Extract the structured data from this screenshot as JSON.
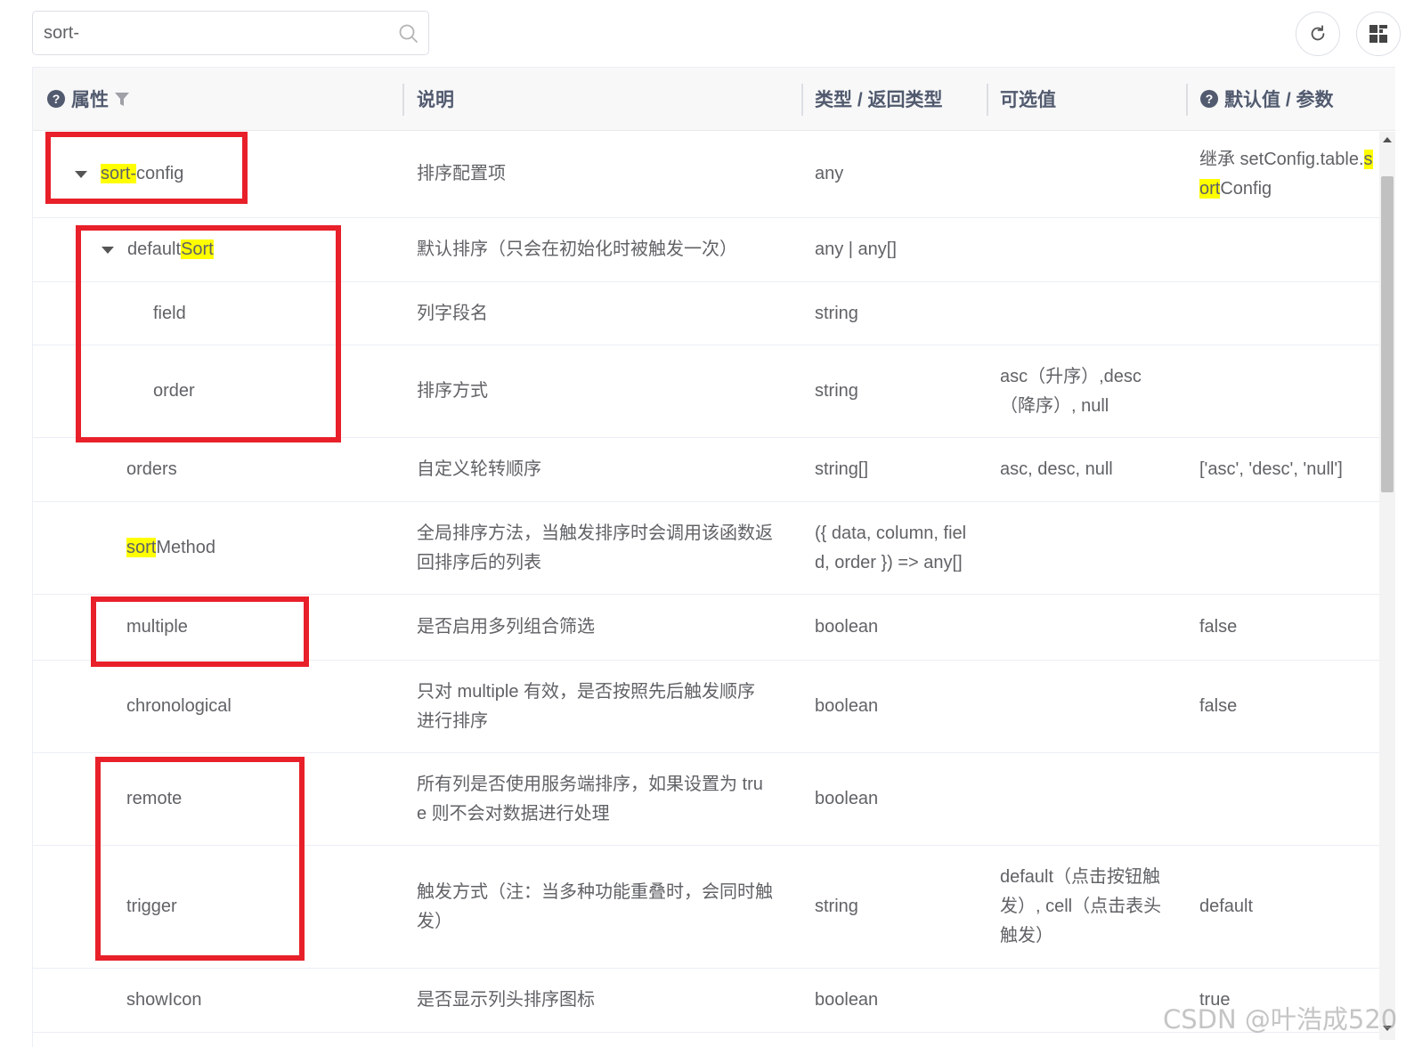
{
  "search": {
    "value": "sort-",
    "search_icon": "search-icon"
  },
  "toolbar": {
    "refresh_icon": "refresh-icon",
    "columns_icon": "grid-columns-icon"
  },
  "table": {
    "headers": {
      "attr": "属性",
      "desc": "说明",
      "type": "类型 / 返回类型",
      "options": "可选值",
      "default": "默认值 / 参数"
    },
    "rows": [
      {
        "name_pre": "",
        "name_hl": "sort-",
        "name_post": "config",
        "desc": "排序配置项",
        "type": "any",
        "options": "",
        "default_1_pre": "继承 setConfig.table.",
        "default_1_hl": "s",
        "default_2_hl": "ort",
        "default_2_post": "Config"
      },
      {
        "name_pre": "defaultSort_left",
        "name_pre_text": "default",
        "name_hl": "Sort",
        "desc": "默认排序（只会在初始化时被触发一次）",
        "type": "any | any[]",
        "options": "",
        "default": ""
      },
      {
        "name": "field",
        "desc": "列字段名",
        "type": "string",
        "options": "",
        "default": ""
      },
      {
        "name": "order",
        "desc": "排序方式",
        "type": "string",
        "options_1": "asc（升序）,desc",
        "options_2": "（降序）, null",
        "default": ""
      },
      {
        "name": "orders",
        "desc": "自定义轮转顺序",
        "type": "string[]",
        "options": "asc, desc, null",
        "default": "['asc', 'desc', 'null']"
      },
      {
        "name_hl": "sort",
        "name_post": "Method",
        "desc_1": "全局排序方法，当触发排序时会调用该函数返",
        "desc_2": "回排序后的列表",
        "type_1": "({ data, column, fiel",
        "type_2": "d, order }) => any[]",
        "options": "",
        "default": ""
      },
      {
        "name": "multiple",
        "desc": "是否启用多列组合筛选",
        "type": "boolean",
        "options": "",
        "default": "false"
      },
      {
        "name": "chronological",
        "desc_1": "只对 multiple 有效，是否按照先后触发顺序",
        "desc_2": "进行排序",
        "type": "boolean",
        "options": "",
        "default": "false"
      },
      {
        "name": "remote",
        "desc_1": "所有列是否使用服务端排序，如果设置为 tru",
        "desc_2": "e 则不会对数据进行处理",
        "type": "boolean",
        "options": "",
        "default": ""
      },
      {
        "name": "trigger",
        "desc_1": "触发方式（注：当多种功能重叠时，会同时触",
        "desc_2": "发）",
        "type": "string",
        "options_1": "default（点击按钮触",
        "options_2": "发）, cell（点击表头",
        "options_3": "触发）",
        "default": "default"
      },
      {
        "name": "showIcon",
        "desc": "是否显示列头排序图标",
        "type": "boolean",
        "options": "",
        "default": "true"
      }
    ]
  },
  "watermark": "CSDN @叶浩成520",
  "colors": {
    "highlight": "#ffff00",
    "annotation_red": "#e8202a",
    "header_bg": "#f8f8f9"
  }
}
